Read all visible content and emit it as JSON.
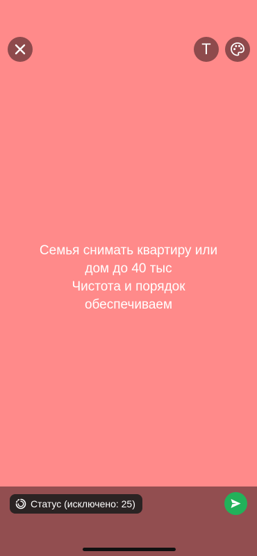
{
  "background_color": "#ff8a8a",
  "toolbar": {
    "close_icon": "close-icon",
    "text_tool_label": "T",
    "palette_icon": "palette-icon"
  },
  "status": {
    "text": "Семья снимать квартиру или\nдом до 40 тыс\nЧистота и порядок\nобеспечиваем"
  },
  "bottom_bar": {
    "privacy_label": "Статус (исключено: 25)",
    "privacy_icon": "status-privacy-icon",
    "send_icon": "send-icon",
    "send_color": "#22b15a"
  }
}
